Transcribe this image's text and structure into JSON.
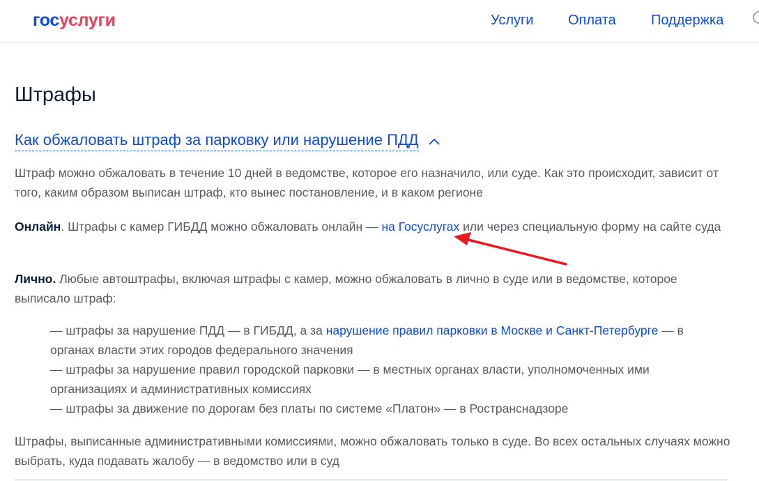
{
  "header": {
    "logo": {
      "part1": "гос",
      "part2": "услуги"
    },
    "nav": [
      {
        "label": "Услуги"
      },
      {
        "label": "Оплата"
      },
      {
        "label": "Поддержка"
      }
    ]
  },
  "page": {
    "title": "Штрафы",
    "accordion": {
      "title": "Как обжаловать штраф за парковку или нарушение ПДД",
      "expanded": true
    },
    "intro": "Штраф можно обжаловать в течение 10 дней в ведомстве, которое его назначило, или суде. Как это происходит, зависит от того, каким образом выписан штраф, кто вынес постановление, и в каком регионе",
    "online": {
      "bold": "Онлайн",
      "before": ". Штрафы с камер ГИБДД можно обжаловать онлайн — ",
      "link": "на Госуслугах",
      "after": " или через специальную форму на сайте суда"
    },
    "personal": {
      "bold": "Лично.",
      "text": " Любые автоштрафы, включая штрафы с камер, можно обжаловать в лично в суде или в ведомстве, которое выписало штраф:"
    },
    "list": {
      "item1_before": "— штрафы за нарушение ПДД — в ГИБДД, а за ",
      "item1_link": "нарушение правил парковки в Москве и Санкт-Петербурге",
      "item1_after": " — в органах власти этих городов федерального значения",
      "item2": "— штрафы за нарушение правил городской парковки — в местных органах власти, уполномоченных ими организациях и административных комиссиях",
      "item3": "— штрафы за движение по дорогам без платы по системе «Платон» — в Ространснадзоре"
    },
    "closing": "Штрафы, выписанные административными комиссиями, можно обжаловать только в суде. Во всех остальных случаях можно выбрать, куда подавать жалобу — в ведомство или в суд"
  },
  "colors": {
    "link": "#0d4cd3",
    "logo_blue": "#0d4cd3",
    "logo_red": "#ee3f58",
    "text": "#555b61",
    "heading": "#0b1f33",
    "annotation_arrow": "#e8191f"
  },
  "icons": {
    "accordion_toggle": "chevron-up-icon",
    "annotation": "red-arrow-icon"
  }
}
